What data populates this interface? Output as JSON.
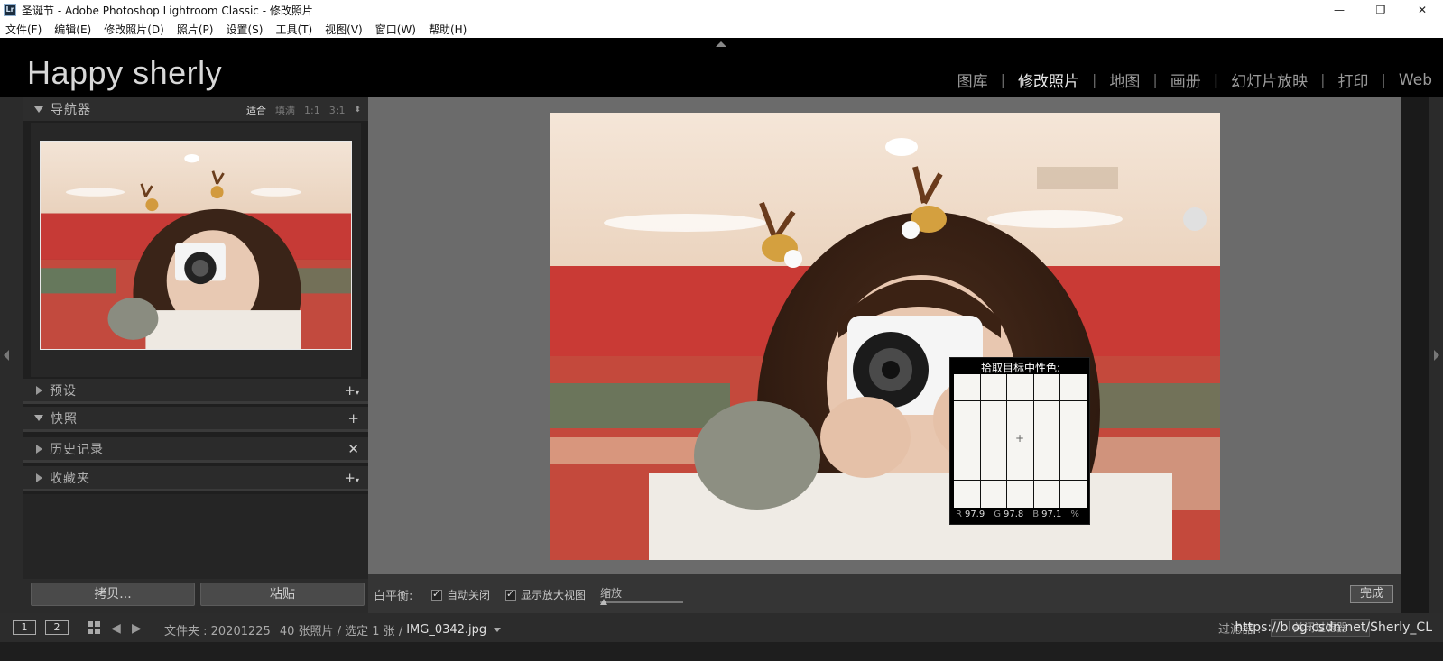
{
  "window": {
    "logo": "Lr",
    "title": "圣诞节 - Adobe Photoshop Lightroom Classic - 修改照片",
    "minimize": "—",
    "restore": "❐",
    "close": "✕"
  },
  "menu": [
    "文件(F)",
    "编辑(E)",
    "修改照片(D)",
    "照片(P)",
    "设置(S)",
    "工具(T)",
    "视图(V)",
    "窗口(W)",
    "帮助(H)"
  ],
  "identity_plate": "Happy sherly",
  "modules": [
    {
      "label": "图库",
      "active": false
    },
    {
      "label": "修改照片",
      "active": true
    },
    {
      "label": "地图",
      "active": false
    },
    {
      "label": "画册",
      "active": false
    },
    {
      "label": "幻灯片放映",
      "active": false
    },
    {
      "label": "打印",
      "active": false
    },
    {
      "label": "Web",
      "active": false
    }
  ],
  "navigator": {
    "title": "导航器",
    "zoom_options": [
      "适合",
      "填满",
      "1:1",
      "3:1"
    ],
    "zoom_arrows": "⬍"
  },
  "sections": [
    {
      "title": "预设",
      "action": "+",
      "action_has_caret": true
    },
    {
      "title": "快照",
      "action": "+",
      "action_has_caret": false
    },
    {
      "title": "历史记录",
      "action": "✕",
      "action_has_caret": false
    },
    {
      "title": "收藏夹",
      "action": "+",
      "action_has_caret": true
    }
  ],
  "buttons": {
    "copy": "拷贝...",
    "paste": "粘贴"
  },
  "loupe": {
    "title": "拾取目标中性色:",
    "crosshair": "+",
    "r_label": "R",
    "r_value": "97.9",
    "g_label": "G",
    "g_value": "97.8",
    "b_label": "B",
    "b_value": "97.1",
    "unit": "%"
  },
  "toolbar": {
    "label": "白平衡:",
    "auto_dismiss": "自动关闭",
    "show_loupe": "显示放大视图",
    "zoom_label": "缩放",
    "done": "完成"
  },
  "filmstrip": {
    "screen1": "1",
    "screen2": "2",
    "left_arrow": "◀",
    "right_arrow": "▶",
    "folder_label": "文件夹 : 20201225",
    "count": "40 张照片 / 选定 1 张 /",
    "filename": "IMG_0342.jpg",
    "filter_label": "过滤器 :",
    "filter_value": "关闭过滤器"
  },
  "watermark": "https://blog.csdn.net/Sherly_CL",
  "colors": {
    "accent": "#e8e8e8",
    "panel_bg": "#2b2b2b",
    "work_bg": "#6b6b6b"
  }
}
